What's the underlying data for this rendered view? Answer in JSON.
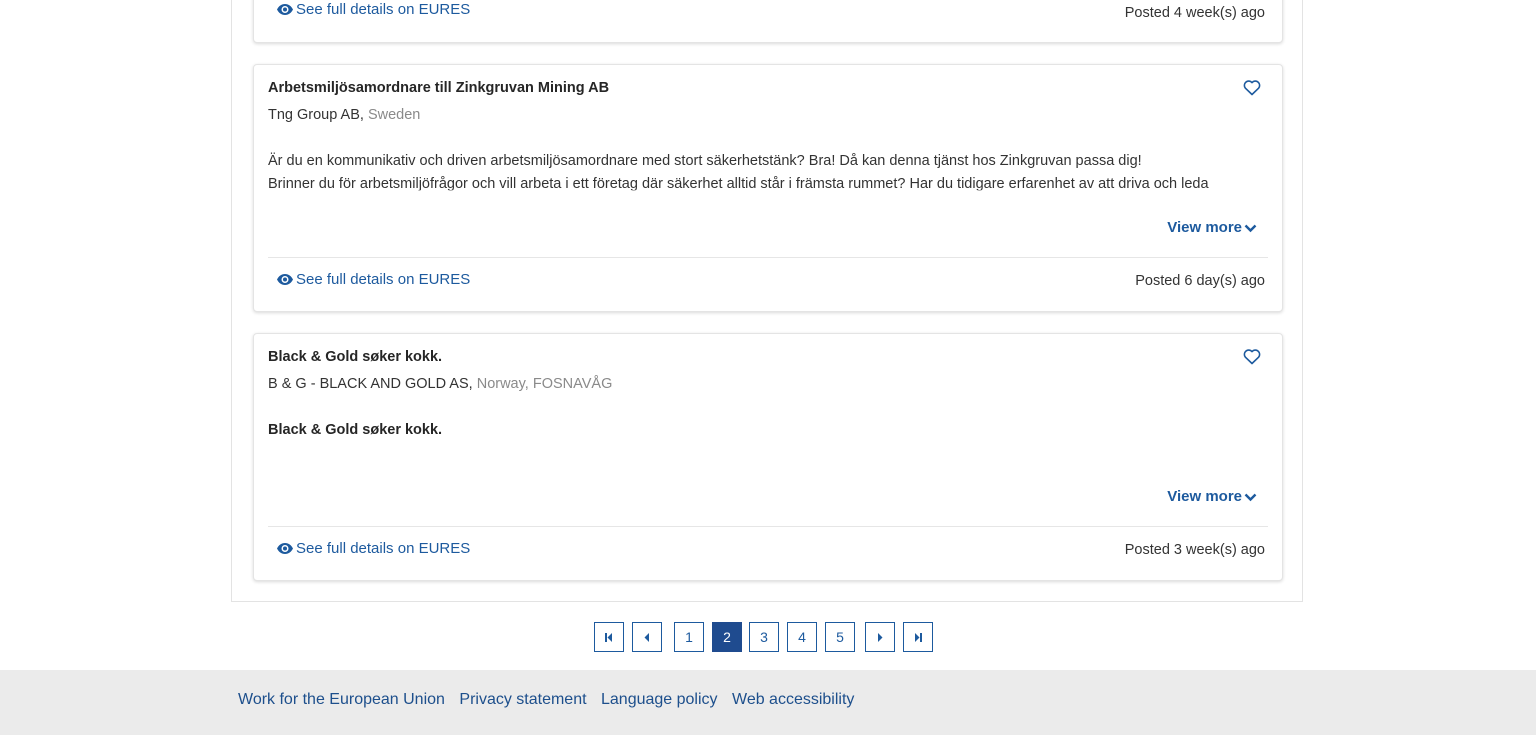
{
  "jobs": [
    {
      "see_details": "See full details on EURES",
      "posted": "Posted 4 week(s) ago"
    },
    {
      "title": "Arbetsmiljösamordnare till Zinkgruvan Mining AB",
      "employer": "Tng Group AB",
      "sep1": ",",
      "country": "Sweden",
      "description": [
        "Är du en kommunikativ och driven arbetsmiljösamordnare med stort säkerhetstänk? Bra! Då kan denna tjänst hos Zinkgruvan passa dig!",
        "Brinner du för arbetsmiljöfrågor och vill arbeta i ett företag där säkerhet alltid står i främsta rummet? Har du tidigare erfarenhet av att driva och leda"
      ],
      "view_more": "View more",
      "see_details": "See full details on EURES",
      "posted": "Posted 6 day(s) ago"
    },
    {
      "title": "Black & Gold søker kokk.",
      "employer": "B & G - BLACK AND GOLD AS",
      "sep1": ",",
      "country": "Norway",
      "sep2": ",",
      "city": "FOSNAVÅG",
      "description_bold": "Black & Gold søker kokk.",
      "view_more": "View more",
      "see_details": "See full details on EURES",
      "posted": "Posted 3 week(s) ago"
    }
  ],
  "pagination": {
    "pages": [
      "1",
      "2",
      "3",
      "4",
      "5"
    ],
    "current": "2"
  },
  "footer": {
    "links": [
      "Work for the European Union",
      "Privacy statement",
      "Language policy",
      "Web accessibility"
    ]
  },
  "colors": {
    "link": "#1d5a9e",
    "active_page": "#1f4b8f",
    "footer_bg": "#ebebeb"
  },
  "icons": {
    "eye": "eye-icon",
    "heart": "heart-outline-icon",
    "chevron": "chevron-down-icon",
    "first": "first-page-icon",
    "prev": "previous-page-icon",
    "next": "next-page-icon",
    "last": "last-page-icon"
  }
}
